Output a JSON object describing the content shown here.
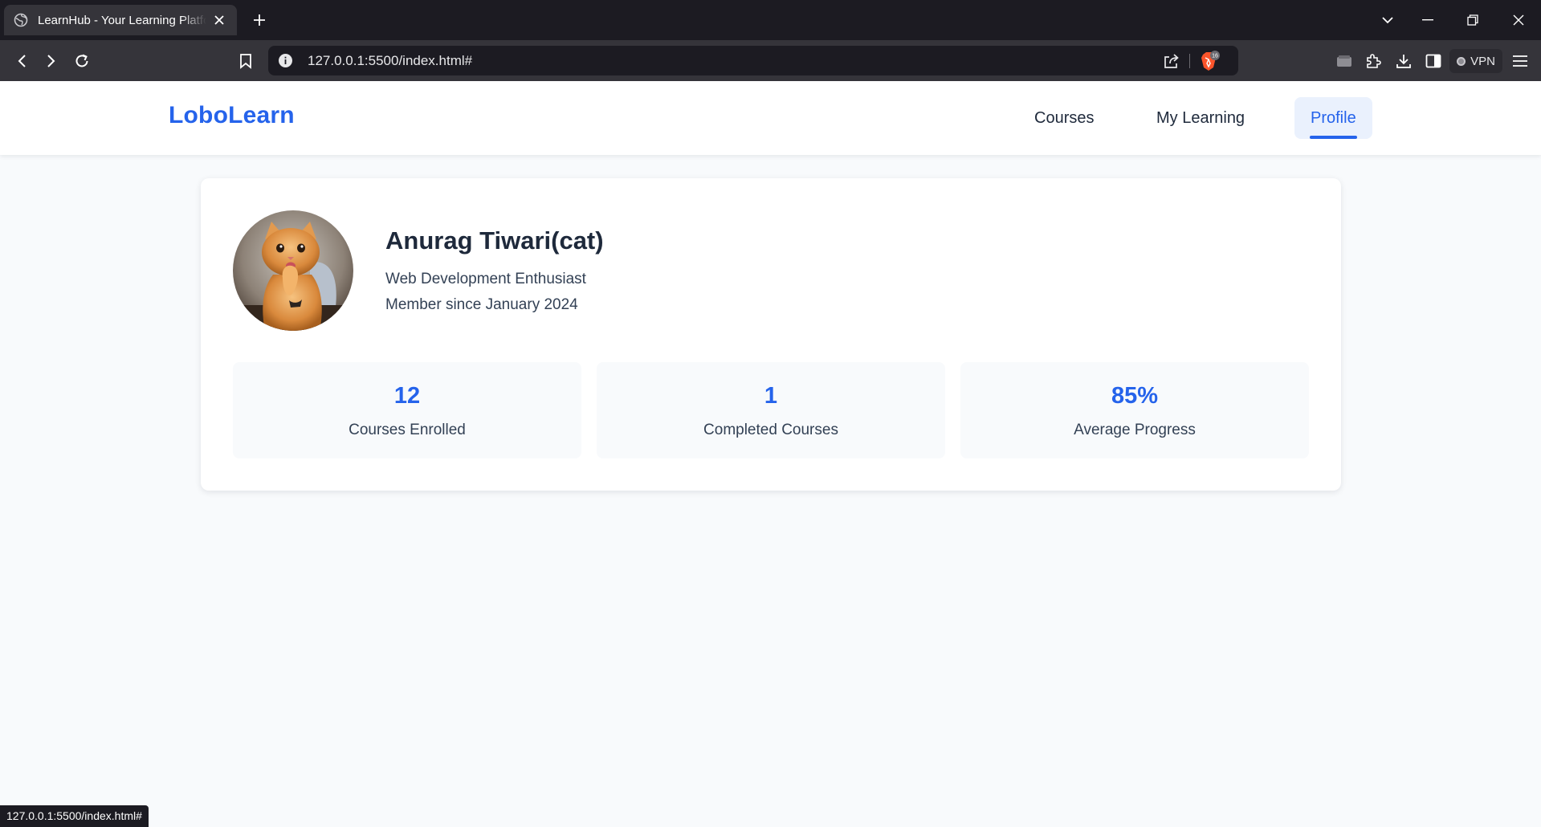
{
  "browser": {
    "tab_title": "LearnHub - Your Learning Platform",
    "url": "127.0.0.1:5500/index.html#",
    "brave_badge_count": "16",
    "vpn_label": "VPN",
    "status_url": "127.0.0.1:5500/index.html#"
  },
  "site": {
    "logo": "LoboLearn",
    "nav": [
      {
        "label": "Courses",
        "active": false
      },
      {
        "label": "My Learning",
        "active": false
      },
      {
        "label": "Profile",
        "active": true
      }
    ],
    "accent_color": "#2563eb"
  },
  "profile": {
    "name": "Anurag Tiwari(cat)",
    "tagline": "Web Development Enthusiast",
    "member_since": "Member since January 2024",
    "avatar": "orange-cat-photo"
  },
  "stats": [
    {
      "value": "12",
      "label": "Courses Enrolled"
    },
    {
      "value": "1",
      "label": "Completed Courses"
    },
    {
      "value": "85%",
      "label": "Average Progress"
    }
  ]
}
